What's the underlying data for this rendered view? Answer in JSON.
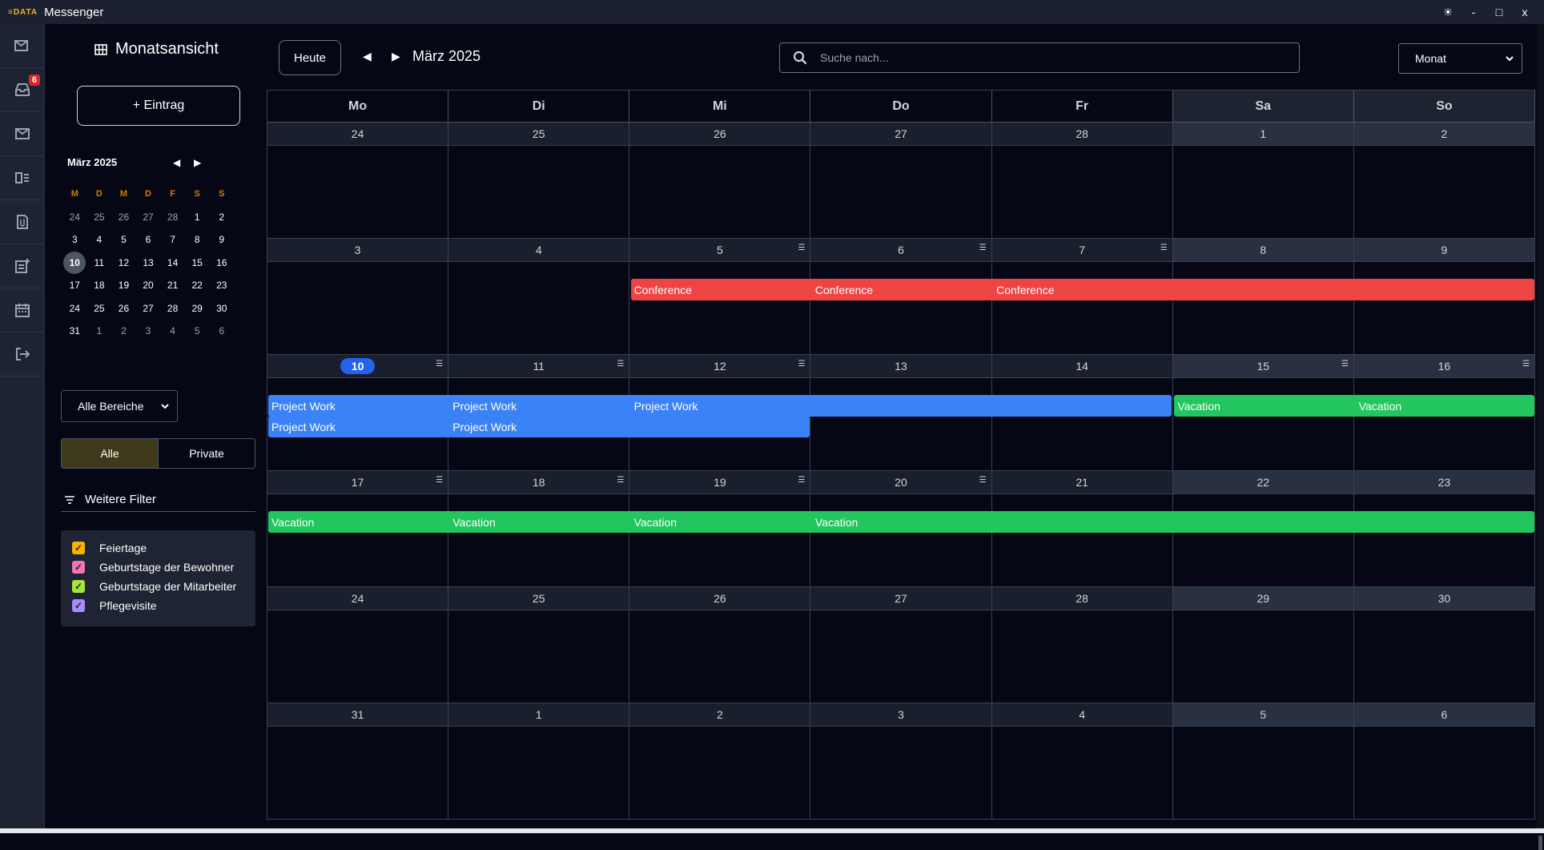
{
  "window": {
    "logo": "≡DATA",
    "title": "Messenger",
    "controls": [
      "☀",
      "-",
      "□",
      "x"
    ]
  },
  "rail": {
    "badge": "6"
  },
  "sidebar": {
    "view_title": "Monatsansicht",
    "new_entry": "+ Eintrag",
    "mini_month": "März 2025",
    "weekday_heads": [
      "M",
      "D",
      "M",
      "D",
      "F",
      "S",
      "S"
    ],
    "weeks": [
      [
        [
          "24",
          1
        ],
        [
          "25",
          1
        ],
        [
          "26",
          1
        ],
        [
          "27",
          1
        ],
        [
          "28",
          1
        ],
        [
          "1",
          0
        ],
        [
          "2",
          0
        ]
      ],
      [
        [
          "3",
          0
        ],
        [
          "4",
          0
        ],
        [
          "5",
          0
        ],
        [
          "6",
          0
        ],
        [
          "7",
          0
        ],
        [
          "8",
          0
        ],
        [
          "9",
          0
        ]
      ],
      [
        [
          "10",
          2
        ],
        [
          "11",
          0
        ],
        [
          "12",
          0
        ],
        [
          "13",
          0
        ],
        [
          "14",
          0
        ],
        [
          "15",
          0
        ],
        [
          "16",
          0
        ]
      ],
      [
        [
          "17",
          0
        ],
        [
          "18",
          0
        ],
        [
          "19",
          0
        ],
        [
          "20",
          0
        ],
        [
          "21",
          0
        ],
        [
          "22",
          0
        ],
        [
          "23",
          0
        ]
      ],
      [
        [
          "24",
          0
        ],
        [
          "25",
          0
        ],
        [
          "26",
          0
        ],
        [
          "27",
          0
        ],
        [
          "28",
          0
        ],
        [
          "29",
          0
        ],
        [
          "30",
          0
        ]
      ],
      [
        [
          "31",
          0
        ],
        [
          "1",
          1
        ],
        [
          "2",
          1
        ],
        [
          "3",
          1
        ],
        [
          "4",
          1
        ],
        [
          "5",
          1
        ],
        [
          "6",
          1
        ]
      ]
    ],
    "area_select": "Alle Bereiche",
    "seg_all": "Alle",
    "seg_private": "Private",
    "filter_head": "Weitere Filter",
    "filters": [
      {
        "label": "Feiertage",
        "color": "#f5b400"
      },
      {
        "label": "Geburtstage der Bewohner",
        "color": "#f472b6"
      },
      {
        "label": "Geburtstage der Mitarbeiter",
        "color": "#a3e635"
      },
      {
        "label": "Pflegevisite",
        "color": "#a78bfa"
      }
    ]
  },
  "toolbar": {
    "today": "Heute",
    "month_label": "März 2025",
    "search_placeholder": "Suche nach...",
    "view_select": "Monat"
  },
  "calendar": {
    "day_heads": [
      "Mo",
      "Di",
      "Mi",
      "Do",
      "Fr",
      "Sa",
      "So"
    ],
    "weeks": [
      {
        "days": [
          "24",
          "25",
          "26",
          "27",
          "28",
          "1",
          "2"
        ],
        "more": [],
        "today": -1,
        "events": []
      },
      {
        "days": [
          "3",
          "4",
          "5",
          "6",
          "7",
          "8",
          "9"
        ],
        "more": [
          2,
          3,
          4
        ],
        "today": -1,
        "events": [
          {
            "title": "Conference",
            "start": 2,
            "end": 7,
            "row": 0,
            "color": "#ef4444",
            "labels": [
              2,
              3,
              4
            ]
          }
        ]
      },
      {
        "days": [
          "10",
          "11",
          "12",
          "13",
          "14",
          "15",
          "16"
        ],
        "more": [
          0,
          1,
          2,
          5,
          6
        ],
        "today": 0,
        "events": [
          {
            "title": "Project Work",
            "start": 0,
            "end": 5,
            "row": 0,
            "color": "#3b82f6",
            "labels": [
              0,
              1,
              2
            ]
          },
          {
            "title": "Vacation",
            "start": 5,
            "end": 7,
            "row": 0,
            "color": "#22c55e",
            "labels": [
              5,
              6
            ]
          },
          {
            "title": "Project Work",
            "start": 0,
            "end": 3,
            "row": 1,
            "color": "#3b82f6",
            "labels": [
              0,
              1
            ]
          }
        ]
      },
      {
        "days": [
          "17",
          "18",
          "19",
          "20",
          "21",
          "22",
          "23"
        ],
        "more": [
          0,
          1,
          2,
          3
        ],
        "today": -1,
        "events": [
          {
            "title": "Vacation",
            "start": 0,
            "end": 7,
            "row": 0,
            "color": "#22c55e",
            "labels": [
              0,
              1,
              2,
              3
            ]
          }
        ]
      },
      {
        "days": [
          "24",
          "25",
          "26",
          "27",
          "28",
          "29",
          "30"
        ],
        "more": [],
        "today": -1,
        "events": []
      },
      {
        "days": [
          "31",
          "1",
          "2",
          "3",
          "4",
          "5",
          "6"
        ],
        "more": [],
        "today": -1,
        "events": []
      }
    ]
  }
}
